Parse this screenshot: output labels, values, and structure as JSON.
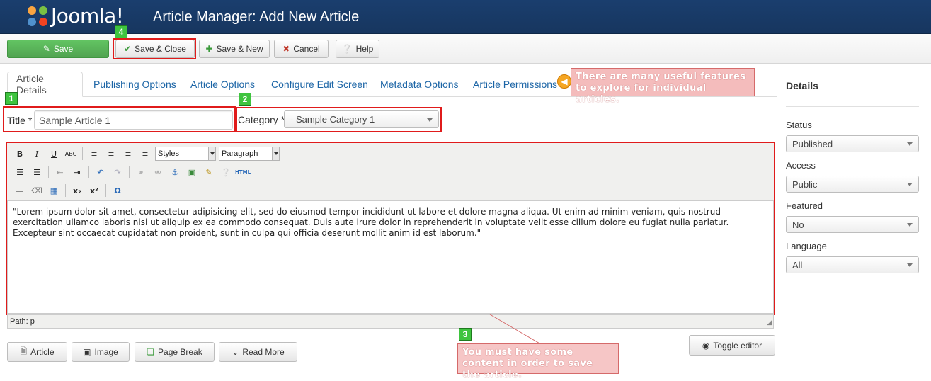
{
  "header": {
    "logo_text": "Joomla!",
    "title": "Article Manager: Add New Article"
  },
  "toolbar": {
    "save": "Save",
    "save_close": "Save & Close",
    "save_new": "Save & New",
    "cancel": "Cancel",
    "help": "Help"
  },
  "tabs": [
    {
      "label": "Article Details"
    },
    {
      "label": "Publishing Options"
    },
    {
      "label": "Article Options"
    },
    {
      "label": "Configure Edit Screen"
    },
    {
      "label": "Metadata Options"
    },
    {
      "label": "Article Permissions"
    }
  ],
  "form": {
    "title_label": "Title *",
    "title_value": "Sample Article 1",
    "category_label": "Category *",
    "category_value": "- Sample Category 1"
  },
  "editor": {
    "styles_select": "Styles",
    "format_select": "Paragraph",
    "content": "\"Lorem ipsum dolor sit amet, consectetur adipisicing elit, sed do eiusmod tempor incididunt ut labore et dolore magna aliqua. Ut enim ad minim veniam, quis nostrud exercitation ullamco laboris nisi ut aliquip ex ea commodo consequat. Duis aute irure dolor in reprehenderit in voluptate velit esse cillum dolore eu fugiat nulla pariatur. Excepteur sint occaecat cupidatat non proident, sunt in culpa qui officia deserunt mollit anim id est laborum.\"",
    "path": "Path: p",
    "toggle": "Toggle editor"
  },
  "buttons_below": {
    "article": "Article",
    "image": "Image",
    "page_break": "Page Break",
    "read_more": "Read More"
  },
  "sidebar": {
    "heading": "Details",
    "fields": [
      {
        "label": "Status",
        "value": "Published"
      },
      {
        "label": "Access",
        "value": "Public"
      },
      {
        "label": "Featured",
        "value": "No"
      },
      {
        "label": "Language",
        "value": "All"
      }
    ]
  },
  "annotations": {
    "badges": [
      "1",
      "2",
      "3",
      "4"
    ],
    "callout_tabs": "There are many useful features to explore for individual articles.",
    "callout_content": "You must have some content in order to save the article."
  },
  "colors": {
    "header": "#1a3e6e",
    "highlight": "#e01b1b",
    "badge": "#3fc43f",
    "link": "#1c65a6"
  }
}
